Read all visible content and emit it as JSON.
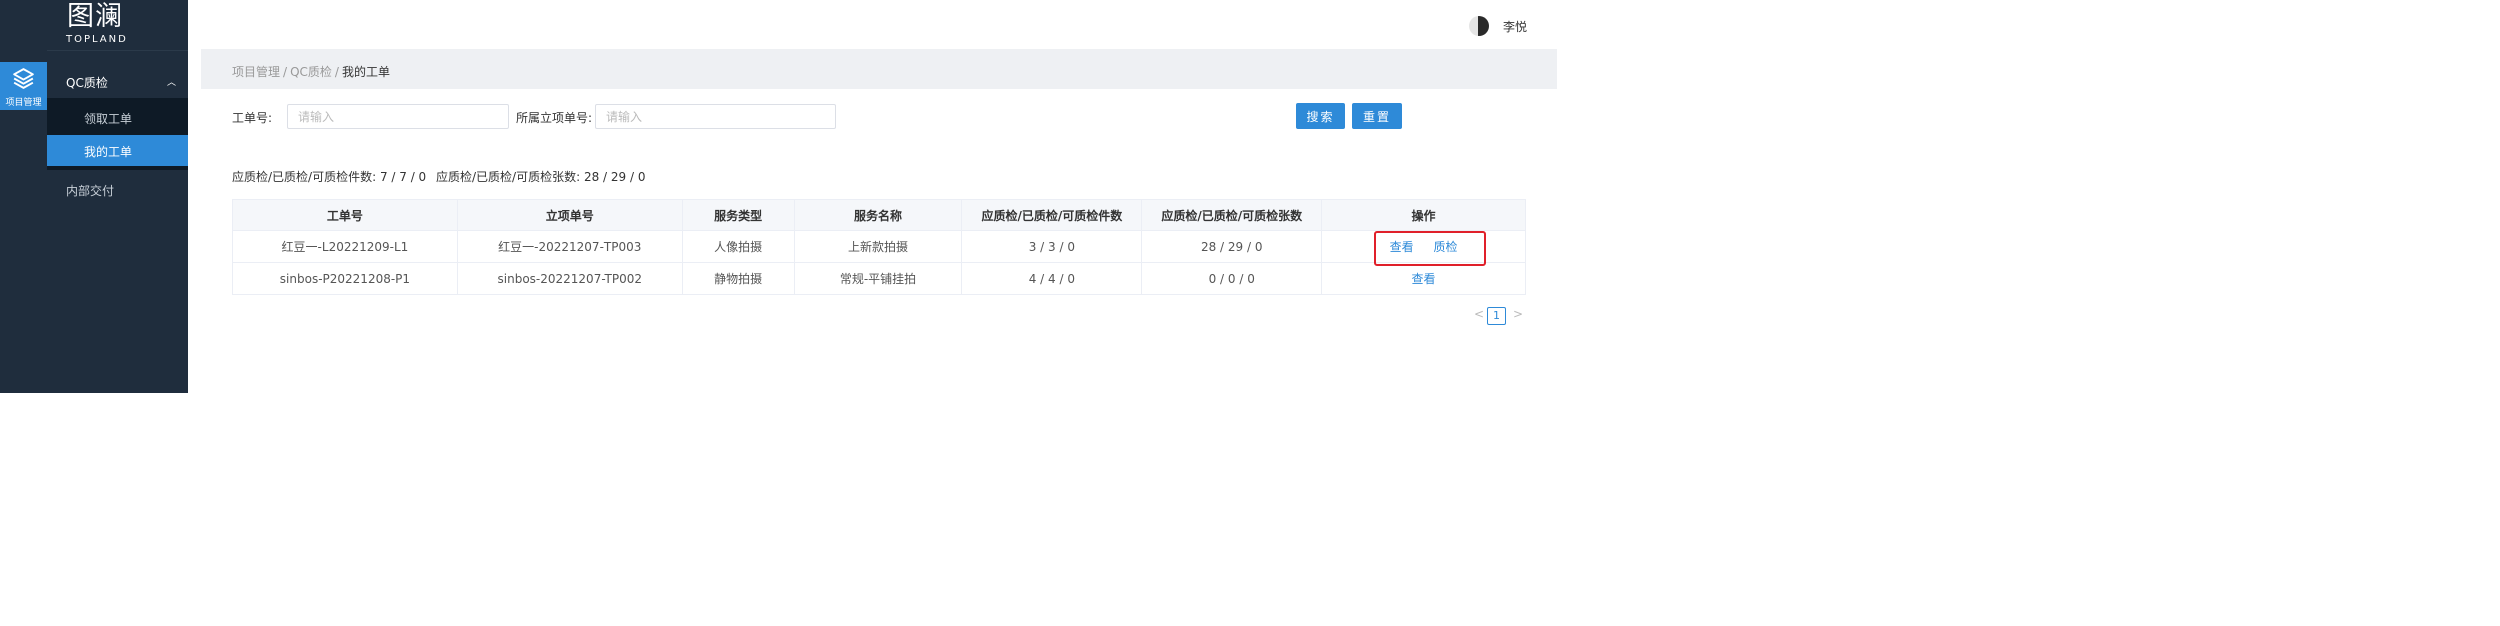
{
  "brand": {
    "mark": "图澜",
    "name": "TOPLAND"
  },
  "rail": {
    "label": "项目管理",
    "icon": "layers-icon"
  },
  "menu": {
    "group_label": "QC质检",
    "items": [
      {
        "label": "领取工单",
        "active": false
      },
      {
        "label": "我的工单",
        "active": true
      }
    ],
    "other_label": "内部交付"
  },
  "header": {
    "username": "李悦"
  },
  "breadcrumb": {
    "items": [
      "项目管理",
      "QC质检"
    ],
    "current": "我的工单"
  },
  "filters": {
    "order_no_label": "工单号:",
    "order_no_placeholder": "请输入",
    "project_no_label": "所属立项单号:",
    "project_no_placeholder": "请输入",
    "search_label": "搜索",
    "reset_label": "重置"
  },
  "stats": {
    "items_label": "应质检/已质检/可质检件数: 7 / 7 / 0",
    "sheets_label": "应质检/已质检/可质检张数: 28 / 29 / 0"
  },
  "table": {
    "columns": [
      "工单号",
      "立项单号",
      "服务类型",
      "服务名称",
      "应质检/已质检/可质检件数",
      "应质检/已质检/可质检张数",
      "操作"
    ],
    "rows": [
      {
        "order_no": "红豆一-L20221209-L1",
        "project_no": "红豆一-20221207-TP003",
        "service_type": "人像拍摄",
        "service_name": "上新款拍摄",
        "items": "3 / 3 / 0",
        "sheets": "28 / 29 / 0",
        "actions": [
          "查看",
          "质检"
        ]
      },
      {
        "order_no": "sinbos-P20221208-P1",
        "project_no": "sinbos-20221207-TP002",
        "service_type": "静物拍摄",
        "service_name": "常规-平铺挂拍",
        "items": "4 / 4 / 0",
        "sheets": "0 / 0 / 0",
        "actions": [
          "查看"
        ]
      }
    ]
  },
  "pagination": {
    "prev": "<",
    "current": "1",
    "next": ">"
  },
  "colors": {
    "primary": "#2e8ad8",
    "sidebar": "#1f2d3d",
    "highlight": "#e0202a"
  }
}
